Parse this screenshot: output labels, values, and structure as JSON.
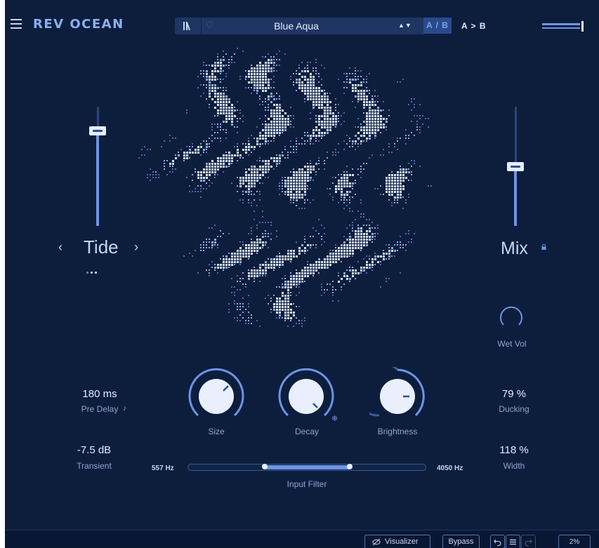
{
  "header": {
    "brand": "REV OCEAN",
    "preset_name": "Blue Aqua",
    "preset_arrows": "▲▼",
    "ab_label": "A / B",
    "a_to_b_label": "A > B"
  },
  "tide": {
    "label": "Tide",
    "level": 0.8
  },
  "mix": {
    "label": "Mix",
    "level": 0.5
  },
  "wet_vol": {
    "label": "Wet Vol"
  },
  "params": {
    "pre_delay": {
      "value": "180 ms",
      "label": "Pre Delay"
    },
    "transient": {
      "value": "-7.5 dB",
      "label": "Transient"
    },
    "ducking": {
      "value": "79 %",
      "label": "Ducking"
    },
    "width": {
      "value": "118 %",
      "label": "Width"
    }
  },
  "knobs": {
    "size": {
      "label": "Size"
    },
    "decay": {
      "label": "Decay"
    },
    "brightness": {
      "label": "Brightness"
    }
  },
  "input_filter": {
    "label": "Input Filter",
    "low": "557 Hz",
    "high": "4050 Hz"
  },
  "footer": {
    "visualizer_label": "Visualizer",
    "bypass_label": "Bypass",
    "zoom_label": "2%"
  },
  "colors": {
    "background": "#0d1e3d",
    "accent": "#6e94e4",
    "text": "#c8d6f5"
  }
}
